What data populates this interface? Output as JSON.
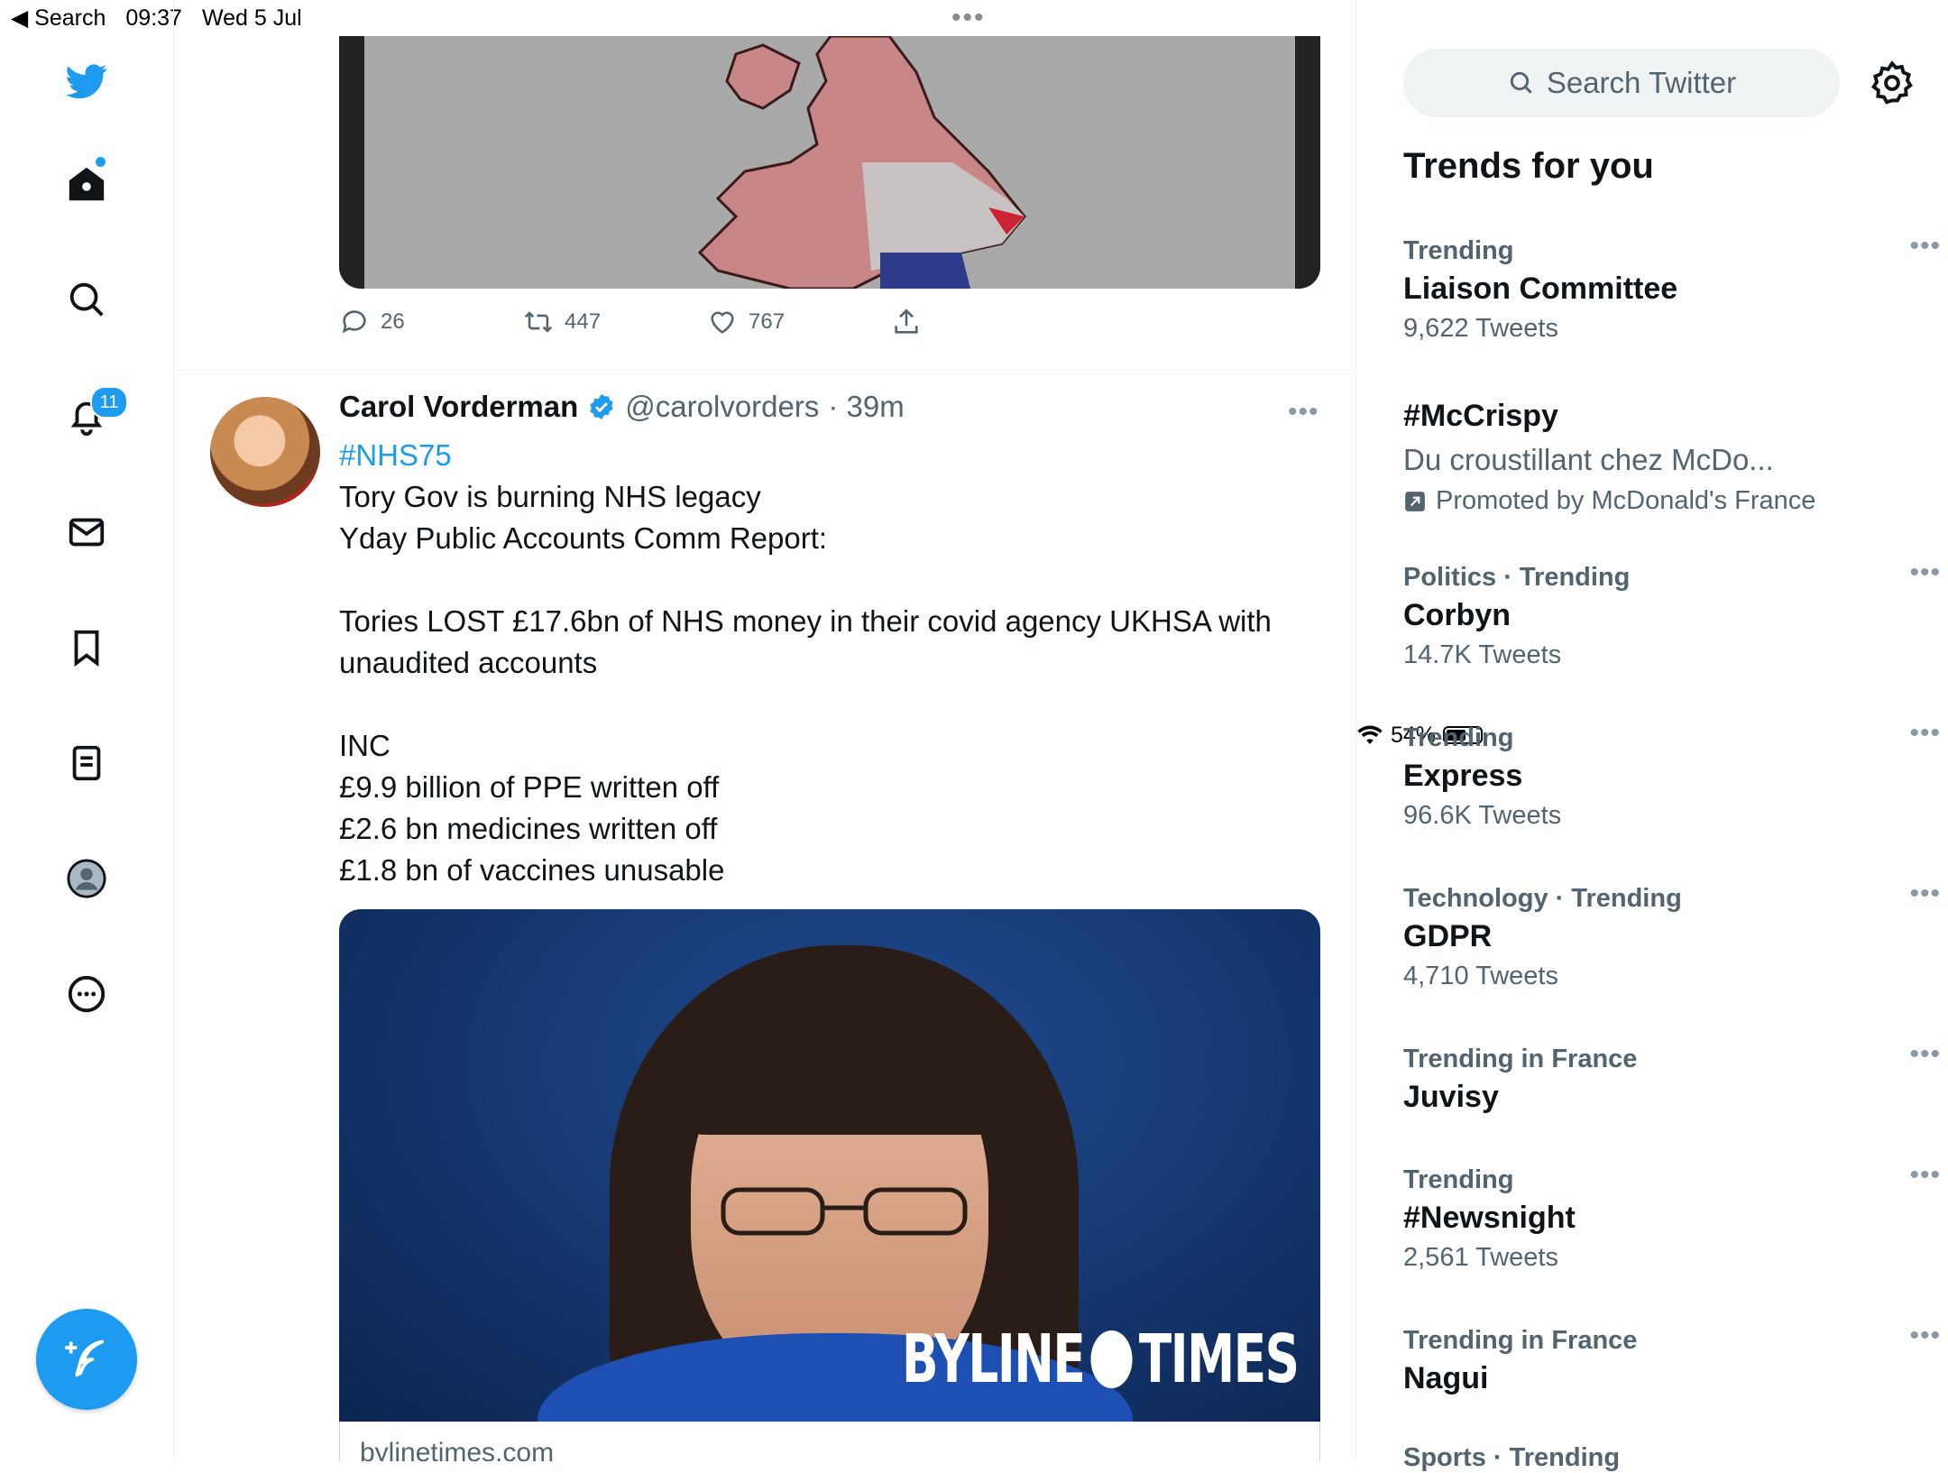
{
  "status_bar": {
    "back_label": "◀ Search",
    "time": "09:37",
    "date": "Wed 5 Jul",
    "battery": "54%",
    "battery_level": 0.54
  },
  "nav": {
    "notifications_badge": "11"
  },
  "previous_tweet": {
    "replies": "26",
    "retweets": "447",
    "likes": "767"
  },
  "tweet": {
    "author_name": "Carol Vorderman",
    "handle": "@carolvorders",
    "time": "· 39m",
    "hashtag": "#NHS75",
    "lines": [
      "Tory Gov is burning NHS legacy",
      "Yday Public Accounts Comm Report:",
      "",
      "Tories LOST £17.6bn of NHS money in their covid agency UKHSA with unaudited accounts",
      "",
      "INC",
      "£9.9 billion of PPE written off",
      "£2.6 bn medicines written off",
      "£1.8 bn of vaccines unusable"
    ],
    "image_logo_left": "BYLINE",
    "image_logo_right": "TIMES",
    "link_domain": "bylinetimes.com"
  },
  "sidebar": {
    "search_placeholder": "Search Twitter",
    "trends_title": "Trends for you",
    "trends": [
      {
        "meta": "Trending",
        "name": "Liaison Committee",
        "count": "9,622 Tweets"
      },
      {
        "meta": "",
        "name": "#McCrispy",
        "description": "Du croustillant chez McDo...",
        "promoted": "Promoted by McDonald's France"
      },
      {
        "meta": "Politics · Trending",
        "name": "Corbyn",
        "count": "14.7K Tweets"
      },
      {
        "meta": "Trending",
        "name": "Express",
        "count": "96.6K Tweets"
      },
      {
        "meta": "Technology · Trending",
        "name": "GDPR",
        "count": "4,710 Tweets"
      },
      {
        "meta": "Trending in France",
        "name": "Juvisy",
        "count": ""
      },
      {
        "meta": "Trending",
        "name": "#Newsnight",
        "count": "2,561 Tweets"
      },
      {
        "meta": "Trending in France",
        "name": "Nagui",
        "count": ""
      },
      {
        "meta": "Sports · Trending",
        "name": "",
        "count": ""
      }
    ]
  }
}
